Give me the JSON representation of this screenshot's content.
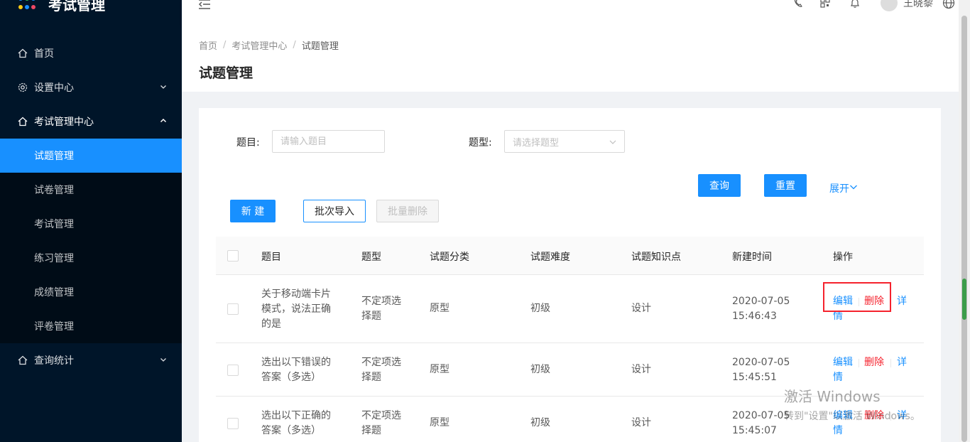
{
  "app": {
    "title": "考试管理"
  },
  "sidebar": {
    "items": [
      {
        "label": "首页"
      },
      {
        "label": "设置中心"
      },
      {
        "label": "考试管理中心"
      },
      {
        "label": "查询统计"
      }
    ],
    "submenu": [
      {
        "label": "试题管理",
        "active": true
      },
      {
        "label": "试卷管理"
      },
      {
        "label": "考试管理"
      },
      {
        "label": "练习管理"
      },
      {
        "label": "成绩管理"
      },
      {
        "label": "评卷管理"
      }
    ]
  },
  "header": {
    "user_name": "王晓黎",
    "icons": [
      "menu-fold-icon",
      "phone-icon",
      "qrcode-icon",
      "bell-icon",
      "avatar",
      "globe-icon"
    ]
  },
  "breadcrumb": {
    "items": [
      "首页",
      "考试管理中心",
      "试题管理"
    ]
  },
  "page": {
    "title": "试题管理"
  },
  "filters": {
    "question_label": "题目:",
    "question_placeholder": "请输入题目",
    "type_label": "题型:",
    "type_placeholder": "请选择题型",
    "query_button": "查询",
    "reset_button": "重置",
    "expand_link": "展开"
  },
  "toolbar": {
    "new_button": "新 建",
    "import_button": "批次导入",
    "batch_delete_button": "批量删除"
  },
  "table": {
    "columns": [
      "题目",
      "题型",
      "试题分类",
      "试题难度",
      "试题知识点",
      "新建时间",
      "操作"
    ],
    "rows": [
      {
        "title": [
          "关于移动端卡片",
          "模式，说法正确",
          "的是"
        ],
        "type": [
          "不定项选",
          "择题"
        ],
        "category": "原型",
        "difficulty": "初级",
        "knowledge": "设计",
        "created": [
          "2020-07-05",
          "15:46:43"
        ],
        "actions": {
          "edit": "编辑",
          "delete": "删除",
          "detail_1": "详",
          "detail_2": "情"
        }
      },
      {
        "title": [
          "选出以下错误的",
          "答案（多选）"
        ],
        "type": [
          "不定项选",
          "择题"
        ],
        "category": "原型",
        "difficulty": "初级",
        "knowledge": "设计",
        "created": [
          "2020-07-05",
          "15:45:51"
        ],
        "actions": {
          "edit": "编辑",
          "delete": "删除",
          "detail_1": "详",
          "detail_2": "情"
        }
      },
      {
        "title": [
          "选出以下正确的",
          "答案（多选）"
        ],
        "type": [
          "不定项选",
          "择题"
        ],
        "category": "原型",
        "difficulty": "初级",
        "knowledge": "设计",
        "created": [
          "2020-07-05",
          "15:45:07"
        ],
        "actions": {
          "edit": "编辑",
          "delete": "删除",
          "detail_1": "详",
          "detail_2": "情"
        }
      }
    ]
  },
  "watermark": {
    "line1": "激活 Windows",
    "line2": "转到\"设置\"以激活 Windows。"
  },
  "colors": {
    "primary": "#1890ff",
    "danger": "#f5222d",
    "sidebar_bg": "#001529"
  }
}
